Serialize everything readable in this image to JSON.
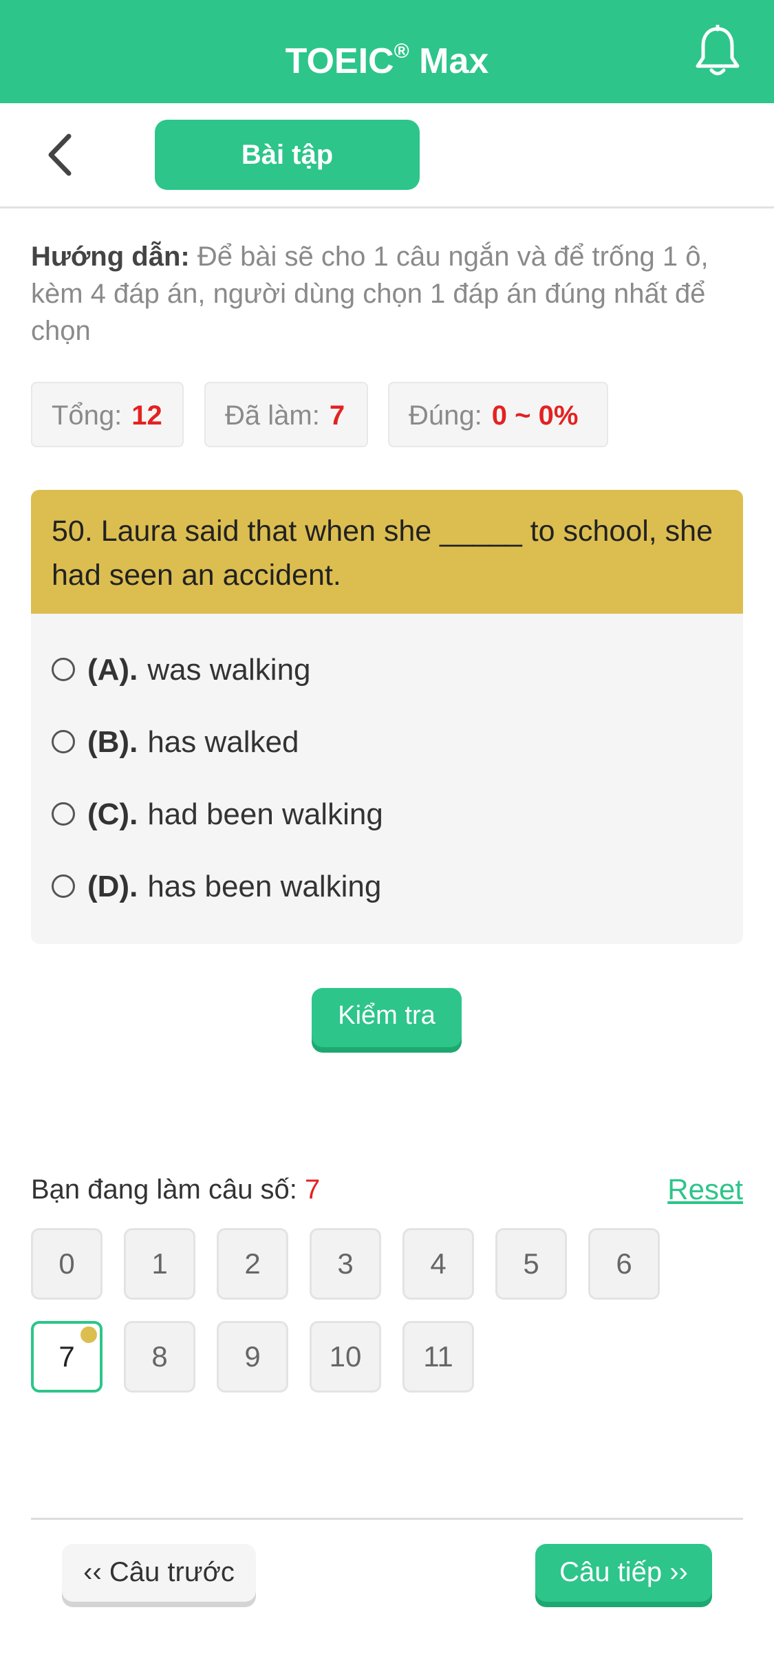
{
  "header": {
    "title": "TOEIC",
    "title_reg": "®",
    "title_suffix": " Max",
    "bell_icon": "bell-icon",
    "accent_color": "#2dc58a"
  },
  "subbar": {
    "back_icon": "chevron-left-icon",
    "tab_label": "Bài tập"
  },
  "instructions": {
    "label": "Hướng dẫn:",
    "text": " Để bài sẽ cho 1 câu ngắn và để trống 1 ô, kèm 4 đáp án, người dùng chọn 1 đáp án đúng nhất để chọn"
  },
  "stats": {
    "total_label": "Tổng:",
    "total_value": "12",
    "done_label": "Đã làm:",
    "done_value": "7",
    "correct_label": "Đúng:",
    "correct_value": "0 ~ 0%"
  },
  "question": {
    "text": "50. Laura said that when she _____ to school, she had seen an accident.",
    "options": [
      {
        "letter": "(A).",
        "text": "was walking"
      },
      {
        "letter": "(B).",
        "text": "has walked"
      },
      {
        "letter": "(C).",
        "text": "had been walking"
      },
      {
        "letter": "(D).",
        "text": "has been walking"
      }
    ]
  },
  "check_button": "Kiểm tra",
  "progress": {
    "current_label": "Bạn đang làm câu số:",
    "current_value": "7",
    "reset_label": "Reset",
    "numbers": [
      "0",
      "1",
      "2",
      "3",
      "4",
      "5",
      "6",
      "7",
      "8",
      "9",
      "10",
      "11"
    ],
    "active_index": 7
  },
  "nav": {
    "prev_label": "‹‹ Câu trước",
    "next_label": "Câu tiếp ››"
  }
}
